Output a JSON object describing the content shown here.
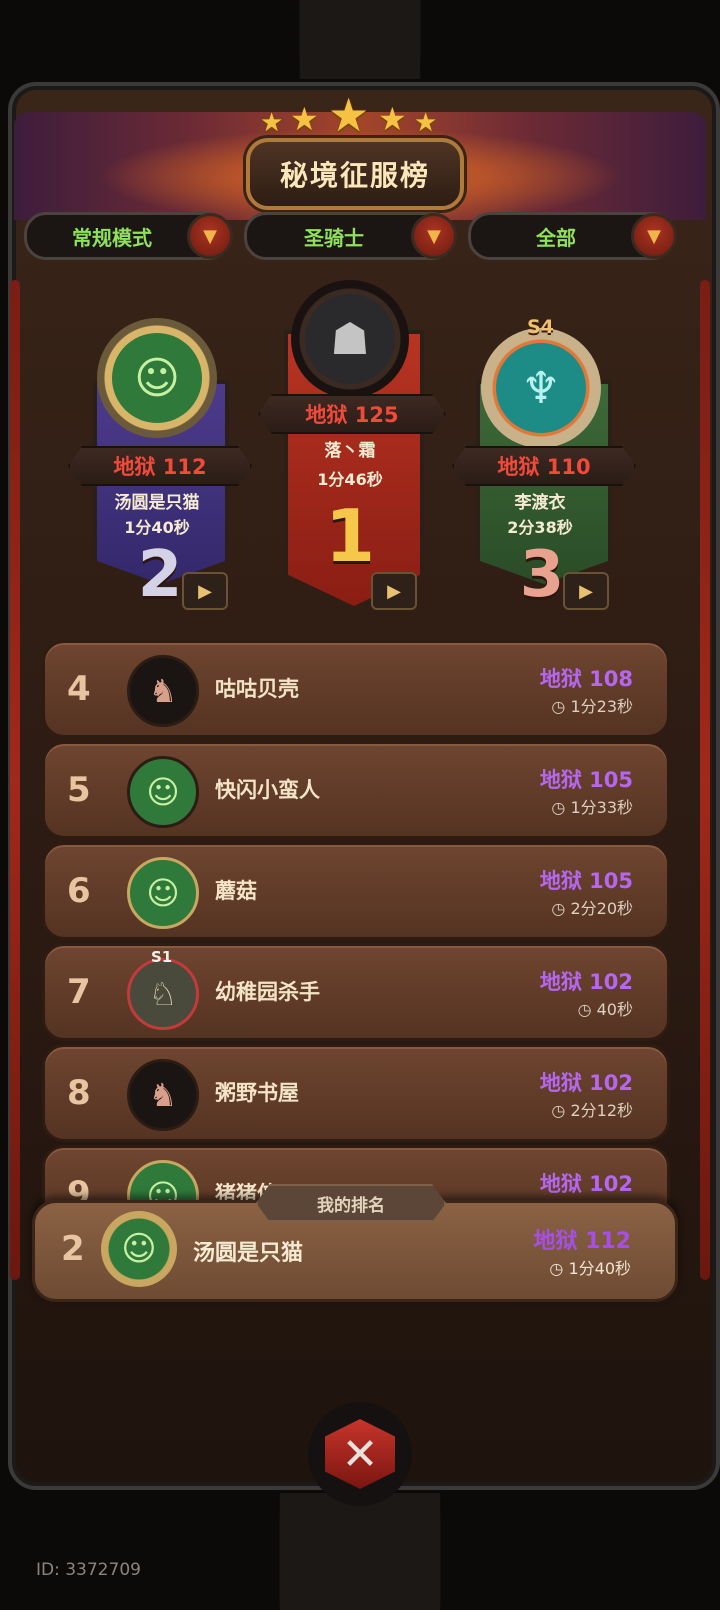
{
  "title": "秘境征服榜",
  "filters": [
    {
      "label": "常规模式"
    },
    {
      "label": "圣骑士"
    },
    {
      "label": "全部"
    }
  ],
  "podium": [
    {
      "place": "1",
      "level": "地狱 125",
      "name": "落丶霜",
      "time": "1分46秒",
      "avatar_icon": "hooded-figure-icon"
    },
    {
      "place": "2",
      "level": "地狱 112",
      "name": "汤圆是只猫",
      "time": "1分40秒",
      "avatar_icon": "green-grin-icon"
    },
    {
      "place": "3",
      "level": "地狱 110",
      "name": "李渡衣",
      "time": "2分38秒",
      "avatar_icon": "dragon-icon",
      "season_badge": "S4"
    }
  ],
  "rows": [
    {
      "rank": "4",
      "name": "咕咕贝壳",
      "level": "地狱 108",
      "time": "1分23秒",
      "avatar_icon": "pig-icon"
    },
    {
      "rank": "5",
      "name": "快闪小蛮人",
      "level": "地狱 105",
      "time": "1分33秒",
      "avatar_icon": "green-grin-icon"
    },
    {
      "rank": "6",
      "name": "蘑菇",
      "level": "地狱 105",
      "time": "2分20秒",
      "avatar_icon": "green-grin-icon"
    },
    {
      "rank": "7",
      "name": "幼稚园杀手",
      "level": "地狱 102",
      "time": "40秒",
      "avatar_icon": "elf-icon",
      "season_badge": "S1"
    },
    {
      "rank": "8",
      "name": "粥野书屋",
      "level": "地狱 102",
      "time": "2分12秒",
      "avatar_icon": "pig-icon"
    },
    {
      "rank": "9",
      "name": "猪猪侠",
      "level": "地狱 102",
      "time": "",
      "avatar_icon": "green-grin-icon"
    }
  ],
  "my_rank": {
    "tag": "我的排名",
    "rank": "2",
    "name": "汤圆是只猫",
    "level": "地狱 112",
    "time": "1分40秒"
  },
  "footer": {
    "uid": "ID: 3372709"
  },
  "colors": {
    "level_purple": "#b667f0",
    "hell_red": "#f24a3a",
    "filter_green": "#8fe05a"
  }
}
